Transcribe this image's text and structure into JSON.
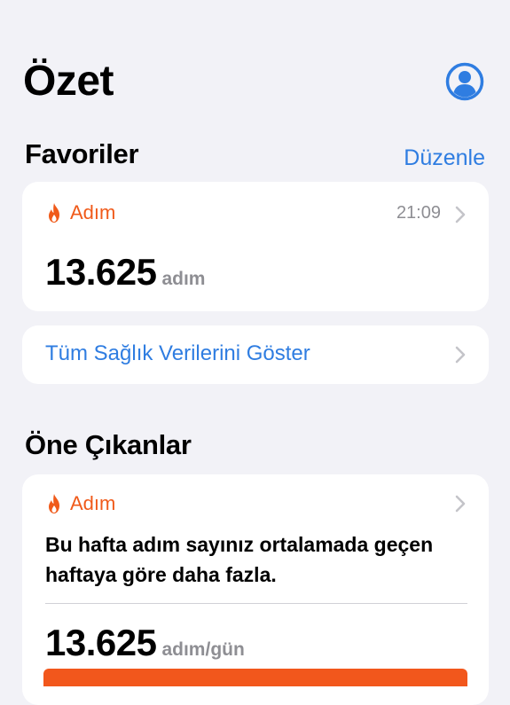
{
  "page": {
    "title": "Özet"
  },
  "header": {
    "avatar_icon": "person-circle-icon"
  },
  "favorites": {
    "title": "Favoriler",
    "edit_label": "Düzenle",
    "steps_card": {
      "icon": "flame-icon",
      "label": "Adım",
      "time": "21:09",
      "value": "13.625",
      "unit": "adım"
    },
    "show_all_label": "Tüm Sağlık Verilerini Göster"
  },
  "highlights": {
    "title": "Öne Çıkanlar",
    "card": {
      "icon": "flame-icon",
      "label": "Adım",
      "description": "Bu hafta adım sayınız ortalamada geçen haftaya göre daha fazla.",
      "value": "13.625",
      "unit": "adım/gün"
    }
  },
  "colors": {
    "accent_blue": "#2f7de1",
    "activity_orange": "#f05a1a",
    "background": "#f2f2f7",
    "secondary_text": "#8e8e93"
  }
}
